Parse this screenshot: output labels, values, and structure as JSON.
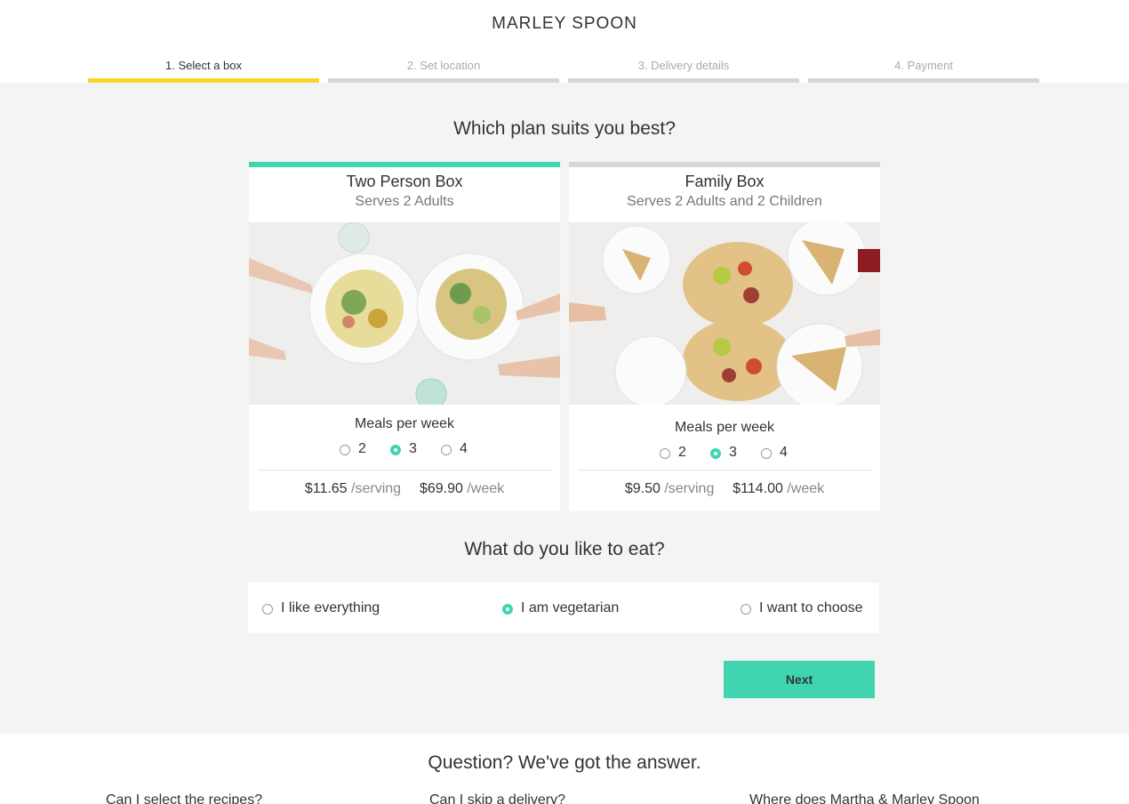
{
  "brand": {
    "logo": "MARLEY SPOON"
  },
  "steps": [
    {
      "label": "1. Select a box",
      "active": true
    },
    {
      "label": "2. Set location",
      "active": false
    },
    {
      "label": "3. Delivery details",
      "active": false
    },
    {
      "label": "4. Payment",
      "active": false
    }
  ],
  "plans_title": "Which plan suits you best?",
  "plans": [
    {
      "title": "Two Person Box",
      "subtitle": "Serves 2 Adults",
      "selected": true,
      "image_alt": "two-person-meal-photo",
      "meals_label": "Meals per week",
      "meal_options": [
        "2",
        "3",
        "4"
      ],
      "selected_meals": "3",
      "price_serving": "$11.65",
      "serving_unit": "/serving",
      "price_week": "$69.90",
      "week_unit": "/week"
    },
    {
      "title": "Family Box",
      "subtitle": "Serves 2  Adults and 2 Children",
      "selected": false,
      "image_alt": "family-meal-photo",
      "meals_label": "Meals per week",
      "meal_options": [
        "2",
        "3",
        "4"
      ],
      "selected_meals": "3",
      "price_serving": "$9.50",
      "serving_unit": "/serving",
      "price_week": "$114.00",
      "week_unit": "/week"
    }
  ],
  "diet": {
    "title": "What do you like to eat?",
    "options": [
      "I like everything",
      "I am vegetarian",
      "I want to choose"
    ],
    "selected": "I am vegetarian"
  },
  "next_label": "Next",
  "faq": {
    "title": "Question? We've got the answer.",
    "questions": [
      "Can I select the recipes?",
      "Can I skip a delivery?",
      "Where does Martha & Marley Spoon"
    ]
  },
  "colors": {
    "accent": "#40d5b0",
    "step_active": "#f8d62b",
    "step_inactive": "#d6d6d6",
    "background": "#f4f4f4"
  }
}
